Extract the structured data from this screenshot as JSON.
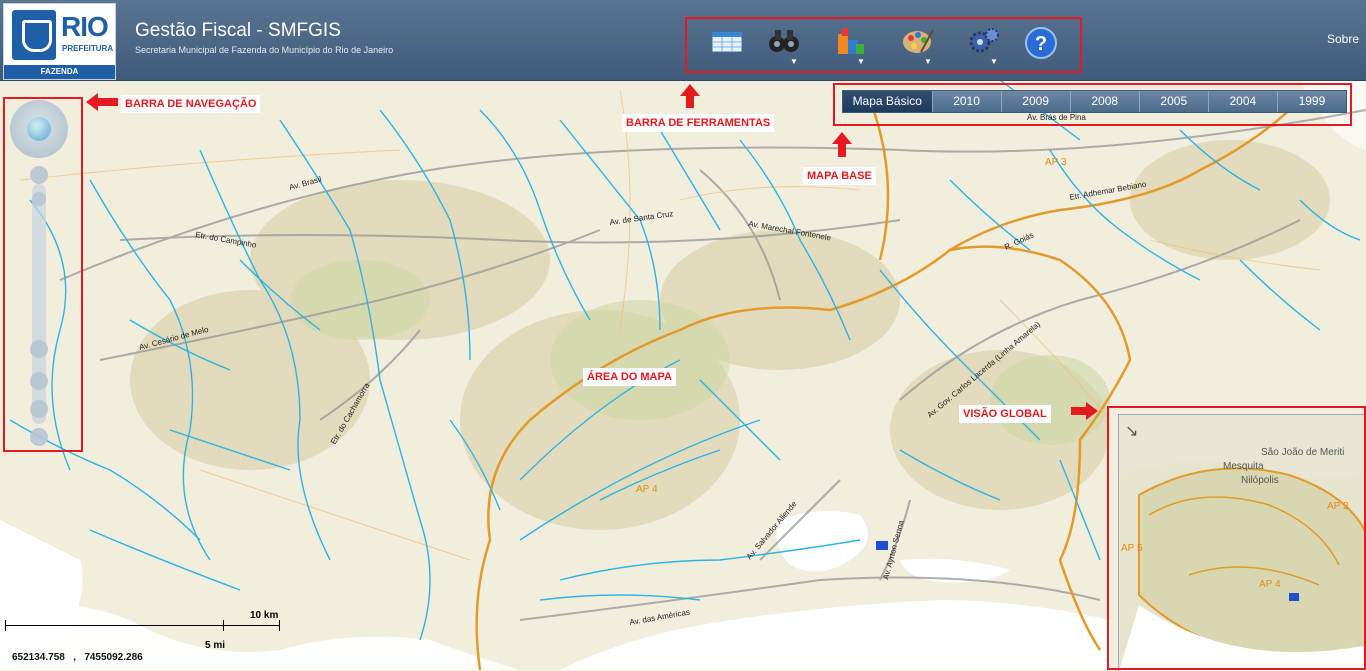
{
  "header": {
    "logo_text": "RIO",
    "logo_subtext": "PREFEITURA",
    "logo_department": "FAZENDA",
    "title": "Gestão Fiscal - SMFGIS",
    "subtitle": "Secretaria Municipal de Fazenda do Município do Rio de Janeiro",
    "about_link": "Sobre"
  },
  "toolbar": {
    "tools": [
      {
        "icon": "table-grid-icon",
        "has_dropdown": false
      },
      {
        "icon": "binoculars-icon",
        "has_dropdown": true
      },
      {
        "icon": "layers-chart-icon",
        "has_dropdown": true
      },
      {
        "icon": "palette-icon",
        "has_dropdown": true
      },
      {
        "icon": "gears-icon",
        "has_dropdown": true
      },
      {
        "icon": "help-icon",
        "has_dropdown": false
      }
    ],
    "dropdown_glyph": "▼"
  },
  "basemap_selector": {
    "options": [
      "Mapa Básico",
      "2010",
      "2009",
      "2008",
      "2005",
      "2004",
      "1999"
    ],
    "selected": "Mapa Básico"
  },
  "annotations": {
    "nav_bar": "BARRA DE NAVEGAÇÃO",
    "toolbar": "BARRA DE FERRAMENTAS",
    "basemap": "MAPA BASE",
    "map_area": "ÁREA DO MAPA",
    "overview": "VISÃO GLOBAL",
    "highlight_color": "#e5191f"
  },
  "map": {
    "street_labels": [
      "Av. Brasil",
      "Etr. do Campinho",
      "Av. de Santa Cruz",
      "Av. Marechal Fontenele",
      "Av. Brás de Pina",
      "Etr. Adhemar Bebiano",
      "R. Goiás",
      "Av. Cesário de Melo",
      "Etr. do Cachamorra",
      "Av. Gov. Carlos Lacerda (Linha Amarela)",
      "Av. Salvador Allende",
      "Av. Ayrton Senna",
      "Av. das Américas"
    ],
    "region_labels": [
      "AP 3",
      "AP 4"
    ],
    "colors": {
      "land": "#f1eedd",
      "river": "#2fb2e6",
      "admin_boundary": "#e39a2a",
      "road": "#9a9a9a",
      "water_body": "#ffffff"
    }
  },
  "scale_bar": {
    "km_label": "10 km",
    "mi_label": "5 mi"
  },
  "coordinates": {
    "x": "652134.758",
    "separator": ",",
    "y": "7455092.286"
  },
  "overview": {
    "labels": [
      "São João de Meriti",
      "Mesquita",
      "Nilópolis"
    ],
    "regions": [
      "AP 3",
      "AP 4",
      "AP 5"
    ]
  }
}
